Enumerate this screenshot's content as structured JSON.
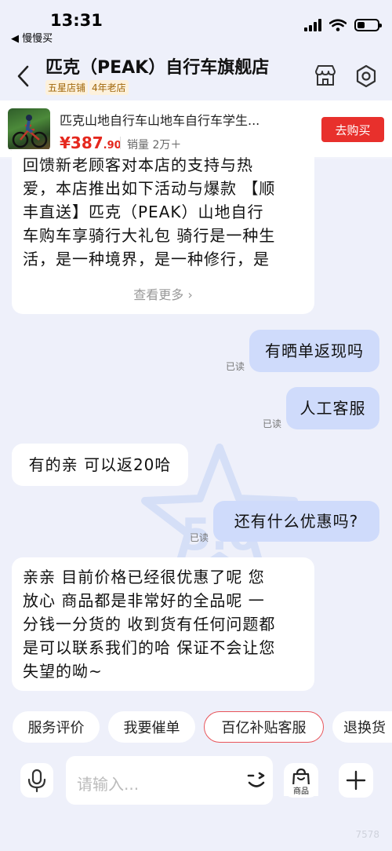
{
  "status_bar": {
    "time": "13:31",
    "back_app": "◀ 慢慢买"
  },
  "header": {
    "title": "匹克（PEAK）自行车旗舰店",
    "badges": [
      "五星店铺",
      "4年老店"
    ]
  },
  "product": {
    "name": "匹克山地自行车山地车自行车学生...",
    "price_symbol": "¥",
    "price_int": "387",
    "price_dec": ".90",
    "sales": "销量 2万＋",
    "buy_label": "去购买"
  },
  "messages": [
    {
      "side": "in",
      "lines": [
        "回馈新老顾客对本店的支持与热",
        "爱，本店推出如下活动与爆款 【顺",
        "丰直送】匹克（PEAK）山地自行",
        "车购车享骑行大礼包 骑行是一种生",
        "活，是一种境界，是一种修行，是"
      ],
      "more_label": "查看更多 ›"
    },
    {
      "side": "out",
      "text": "有晒单返现吗",
      "status": "已读"
    },
    {
      "side": "out",
      "text": "人工客服",
      "status": "已读"
    },
    {
      "side": "in",
      "text": "有的亲 可以返20哈"
    },
    {
      "side": "out",
      "text": "还有什么优惠吗?",
      "status": "已读"
    },
    {
      "side": "in",
      "lines": [
        "亲亲 目前价格已经很优惠了呢 您",
        "放心 商品都是非常好的全品呢 一",
        "分钱一分货的 收到货有任何问题都",
        "是可以联系我们的哈 保证不会让您",
        "失望的呦~"
      ]
    }
  ],
  "watermark_text": "5.0",
  "quick_replies": [
    "服务评价",
    "我要催单",
    "百亿补贴客服",
    "退换货"
  ],
  "input": {
    "placeholder": "请输入...",
    "goods_label": "商品"
  },
  "corner_mark": "7578",
  "colors": {
    "accent_red": "#e8302c",
    "price_red": "#e5281e",
    "out_bubble": "#cfdbfb",
    "background": "#eef0fa"
  },
  "icons": [
    "signal-icon",
    "wifi-icon",
    "battery-icon",
    "back-chevron-icon",
    "store-icon",
    "settings-icon",
    "mic-icon",
    "emoji-icon",
    "goods-icon",
    "plus-icon"
  ]
}
